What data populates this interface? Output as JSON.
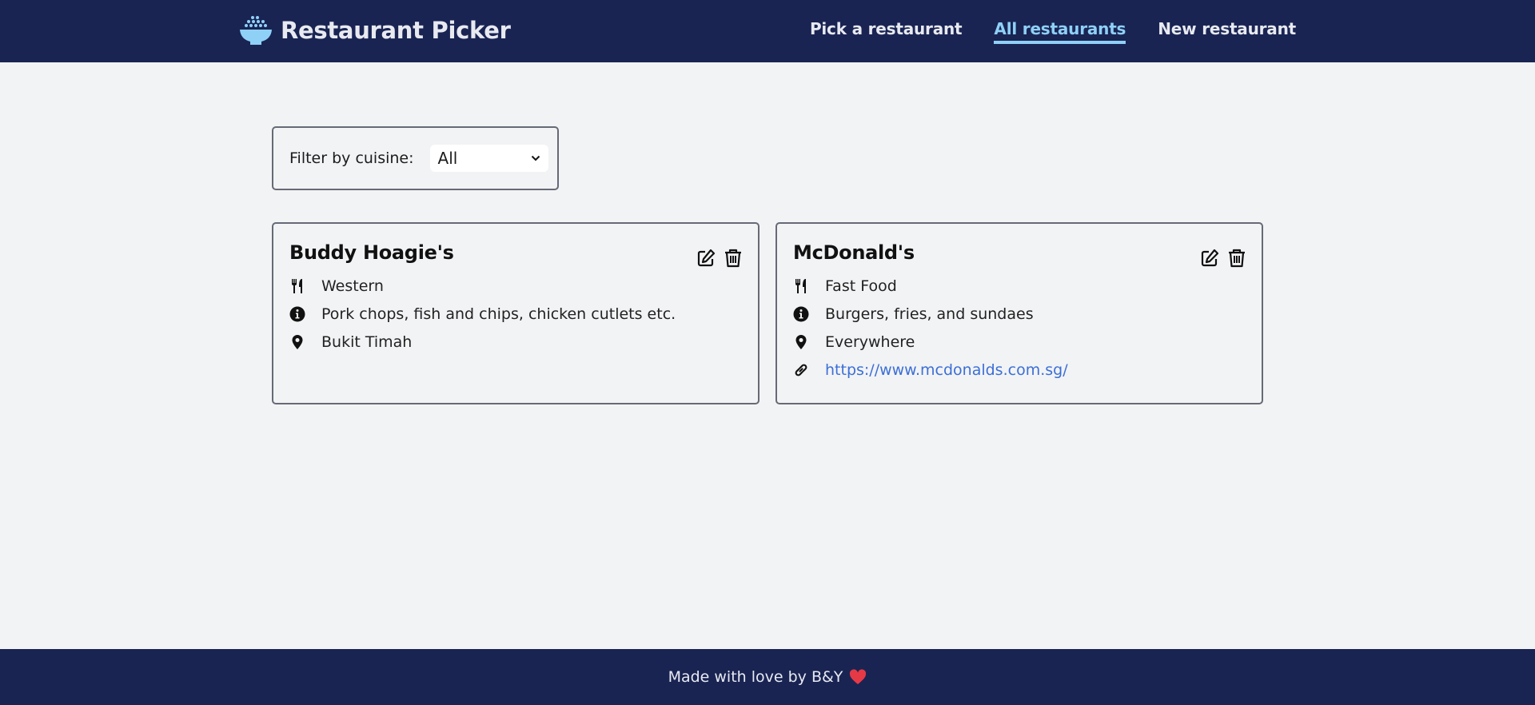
{
  "nav": {
    "brand": "Restaurant Picker",
    "links": [
      {
        "label": "Pick a restaurant",
        "active": false
      },
      {
        "label": "All restaurants",
        "active": true
      },
      {
        "label": "New restaurant",
        "active": false
      }
    ]
  },
  "filter": {
    "label": "Filter by cuisine:",
    "selected": "All"
  },
  "restaurants": [
    {
      "name": "Buddy Hoagie's",
      "cuisine": "Western",
      "description": "Pork chops, fish and chips, chicken cutlets etc.",
      "location": "Bukit Timah",
      "website": ""
    },
    {
      "name": "McDonald's",
      "cuisine": "Fast Food",
      "description": "Burgers, fries, and sundaes",
      "location": "Everywhere",
      "website": "https://www.mcdonalds.com.sg/"
    }
  ],
  "footer": {
    "text": "Made with love by B&Y"
  },
  "colors": {
    "navbar": "#192453",
    "accent": "#8fd0f7",
    "link": "#3b6fd6",
    "background": "#f2f3f5",
    "heart": "#e63946"
  }
}
